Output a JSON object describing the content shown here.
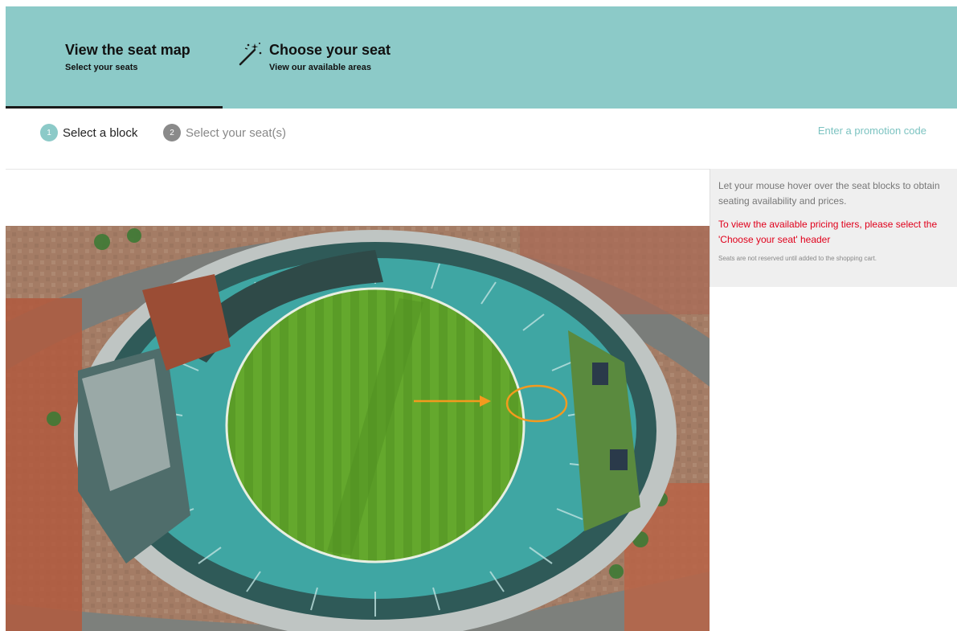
{
  "header": {
    "tabs": [
      {
        "title": "View the seat map",
        "subtitle": "Select your seats",
        "active": true
      },
      {
        "title": "Choose your seat",
        "subtitle": "View our available areas",
        "active": false,
        "icon": "magic-wand-icon"
      }
    ]
  },
  "steps": {
    "items": [
      {
        "number": "1",
        "label": "Select a block"
      },
      {
        "number": "2",
        "label": "Select your seat(s)"
      }
    ],
    "promo_link": "Enter a promotion code"
  },
  "info": {
    "hover_text": "Let your mouse hover over the seat blocks to obtain seating availability and prices.",
    "pricing_text": "To view the available pricing tiers, please select the 'Choose your seat' header",
    "note": "Seats are not reserved until added to the shopping cart."
  },
  "colors": {
    "header_bg": "#8ccac8",
    "accent": "#7cc3c1",
    "warning": "#e0001b",
    "pitch": "#5fa32b",
    "seats": "#3fa6a3",
    "highlight": "#f39a1e"
  }
}
